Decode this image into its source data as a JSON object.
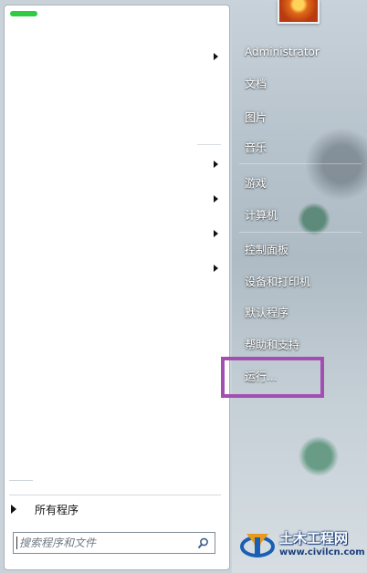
{
  "left_panel": {
    "all_programs_label": "所有程序",
    "search_placeholder": "搜索程序和文件"
  },
  "right_panel": {
    "items": [
      {
        "label": "Administrator"
      },
      {
        "label": "文档"
      },
      {
        "label": "图片"
      },
      {
        "label": "音乐"
      },
      {
        "label": "游戏"
      },
      {
        "label": "计算机"
      },
      {
        "label": "控制面板"
      },
      {
        "label": "设备和打印机"
      },
      {
        "label": "默认程序"
      },
      {
        "label": "帮助和支持"
      },
      {
        "label": "运行..."
      }
    ]
  },
  "watermark": {
    "title": "土木工程网",
    "url": "www.civilcn.com"
  },
  "colors": {
    "highlight": "#a34fb2",
    "pinned_marker": "#2ecc40"
  },
  "icons": [
    "search-icon",
    "submenu-arrow-icon",
    "all-programs-arrow-icon",
    "user-avatar",
    "watermark-logo-icon"
  ]
}
